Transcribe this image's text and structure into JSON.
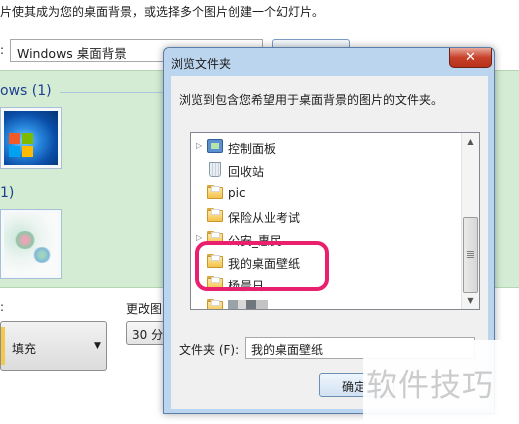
{
  "background_window": {
    "description": "片使其成为您的桌面背景，或选择多个图片创建一个幻灯片。",
    "location_label": ":",
    "location_value": "Windows 桌面背景",
    "groups": [
      {
        "header": "ows (1)"
      },
      {
        "header": "1)"
      }
    ],
    "position_label": ":",
    "position_value": "填充",
    "interval_label": "更改图",
    "interval_value": "30 分"
  },
  "dialog": {
    "title": "浏览文件夹",
    "close_glyph": "✕",
    "instruction": "浏览到包含您希望用于桌面背景的图片的文件夹。",
    "tree_items": [
      {
        "label": "控制面板",
        "icon": "control-panel-icon"
      },
      {
        "label": "回收站",
        "icon": "recycle-bin-icon"
      },
      {
        "label": "pic",
        "icon": "folder-icon"
      },
      {
        "label": "保险从业考试",
        "icon": "folder-icon"
      },
      {
        "label": "公安_惠民",
        "icon": "folder-icon"
      },
      {
        "label": "我的桌面壁纸",
        "icon": "folder-icon",
        "selected": true
      },
      {
        "label": "杨晨日",
        "icon": "folder-icon"
      },
      {
        "label": "",
        "icon": "folder-icon"
      }
    ],
    "folder_label": "文件夹 (F):",
    "folder_value": "我的桌面壁纸",
    "ok_label": "确定"
  },
  "colors": {
    "highlight_ring": "#e8206e",
    "gallery_background": "#d3ecd3",
    "dialog_frame": "#bcd5ee"
  },
  "watermark": "软件技巧"
}
